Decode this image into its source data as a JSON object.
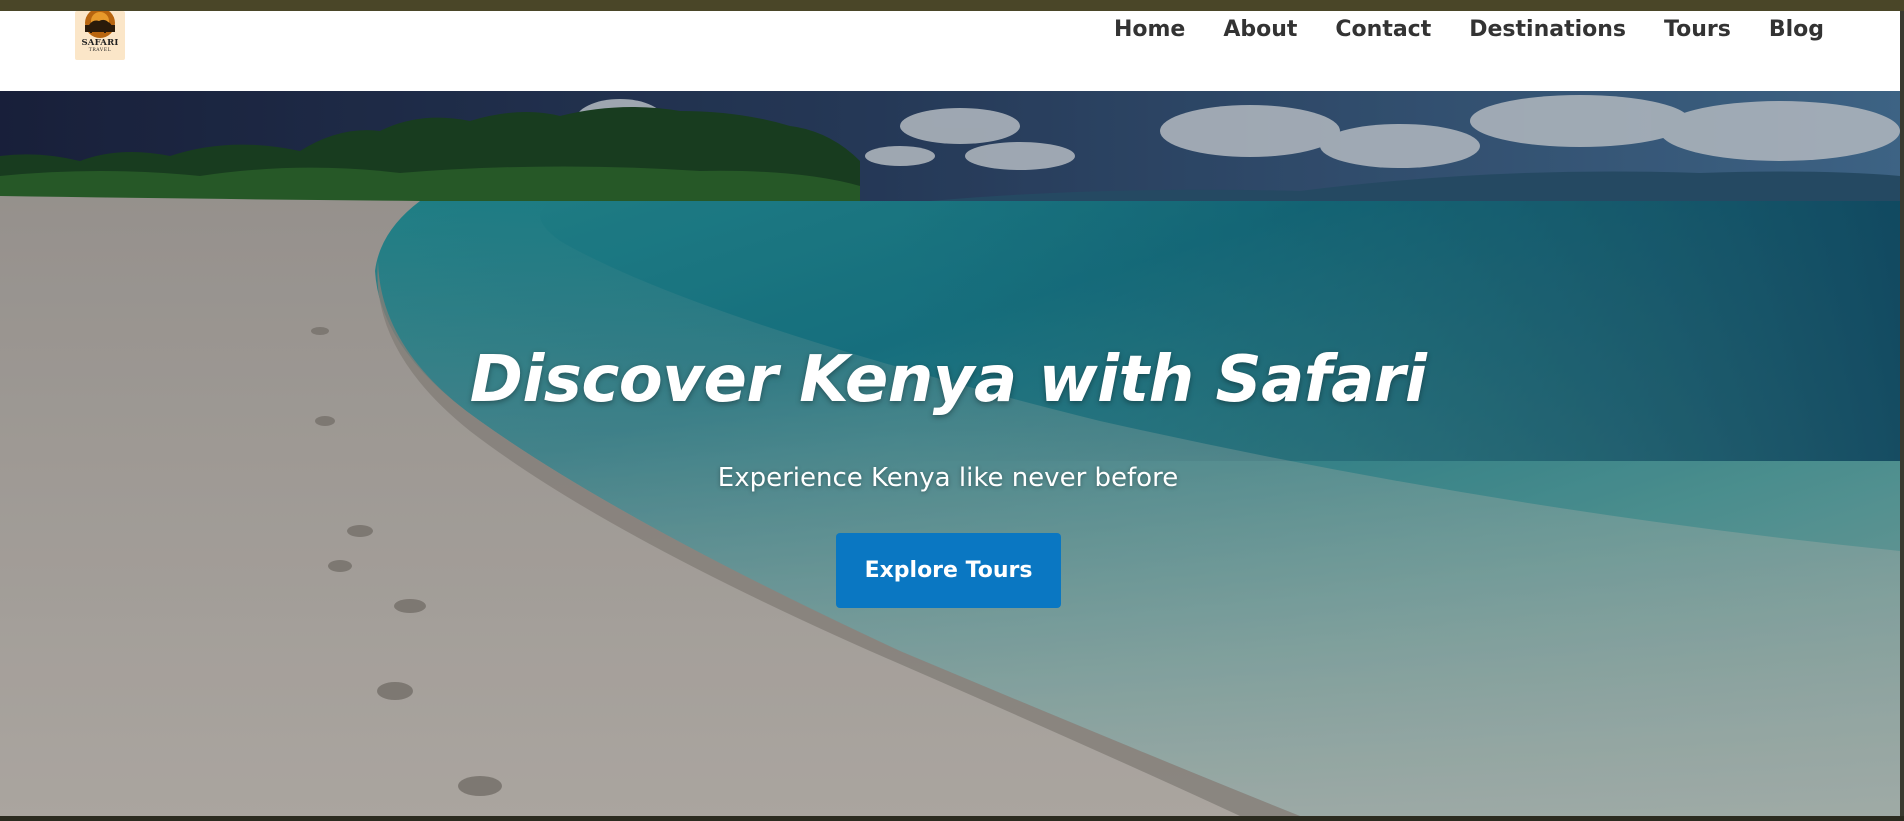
{
  "brand": {
    "logo_icon": "elephant-sunset-icon",
    "logo_name": "SAFARI",
    "logo_sub": "TRAVEL"
  },
  "nav": {
    "items": [
      {
        "label": "Home"
      },
      {
        "label": "About"
      },
      {
        "label": "Contact"
      },
      {
        "label": "Destinations"
      },
      {
        "label": "Tours"
      },
      {
        "label": "Blog"
      }
    ]
  },
  "hero": {
    "title": "Discover Kenya with Safari",
    "subtitle": "Experience Kenya like never before",
    "cta_label": "Explore Tours",
    "image": "tropical-beach-photo"
  },
  "colors": {
    "cta_background": "#0a77c2",
    "nav_text": "#333333",
    "header_background": "#ffffff"
  }
}
